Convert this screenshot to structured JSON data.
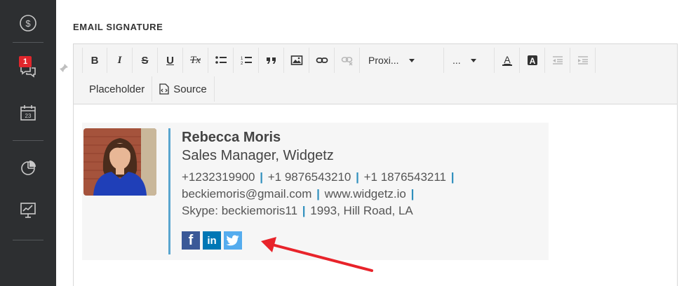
{
  "sidebar": {
    "items": [
      {
        "icon": "dollar-icon"
      },
      {
        "icon": "chat-icon",
        "badge": "1"
      },
      {
        "icon": "calendar-icon",
        "date": "23"
      },
      {
        "icon": "pie-chart-icon"
      },
      {
        "icon": "presentation-chart-icon"
      }
    ]
  },
  "section": {
    "title": "EMAIL SIGNATURE"
  },
  "toolbar": {
    "bold": "B",
    "italic": "I",
    "strike": "S",
    "underline": "U",
    "clear_format": "Tx",
    "font_family": "Proxi...",
    "font_size": "...",
    "placeholder_label": "Placeholder",
    "source_label": "Source"
  },
  "signature": {
    "name": "Rebecca Moris",
    "title": "Sales Manager, Widgetz",
    "phone1": "+1232319900",
    "phone2": "+1 9876543210",
    "phone3": "+1 1876543211",
    "email": "beckiemoris@gmail.com",
    "website": "www.widgetz.io",
    "skype": "Skype: beckiemoris11",
    "address": "1993, Hill Road, LA",
    "separator": "|",
    "social": [
      "facebook-icon",
      "linkedin-icon",
      "twitter-icon"
    ],
    "social_labels": {
      "facebook": "f",
      "linkedin": "in"
    }
  },
  "colors": {
    "sidebar_bg": "#2d2f31",
    "badge": "#e0262c",
    "accent_line": "#5aa6cf",
    "separator": "#2f8fbd",
    "facebook": "#3b5998",
    "linkedin": "#0077b5",
    "twitter": "#55acee",
    "arrow": "#e8232a"
  }
}
